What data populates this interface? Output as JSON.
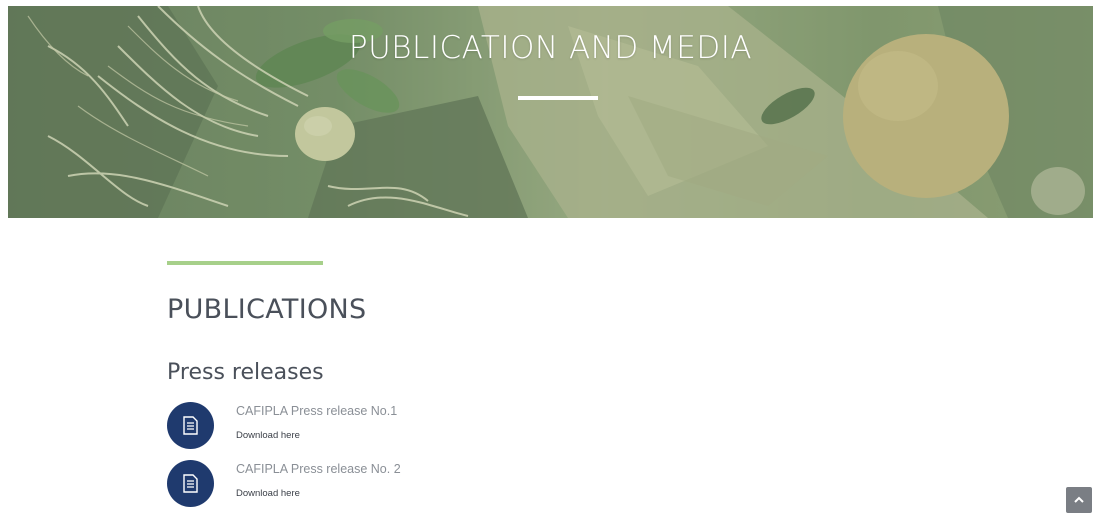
{
  "hero": {
    "title": "PUBLICATION AND MEDIA"
  },
  "publications": {
    "title": "PUBLICATIONS",
    "press_releases": {
      "title": "Press releases",
      "items": [
        {
          "title": "CAFIPLA Press release No.1",
          "link_label": "Download here",
          "icon": "document-icon"
        },
        {
          "title": "CAFIPLA Press release No. 2",
          "link_label": "Download here",
          "icon": "document-icon"
        }
      ]
    }
  },
  "scroll_top": {
    "icon": "chevron-up-icon"
  },
  "colors": {
    "accent_green": "#a7d08a",
    "icon_navy": "#1f3a6e",
    "heading_text": "#4a505a",
    "hero_overlay": "#6f8a62"
  }
}
